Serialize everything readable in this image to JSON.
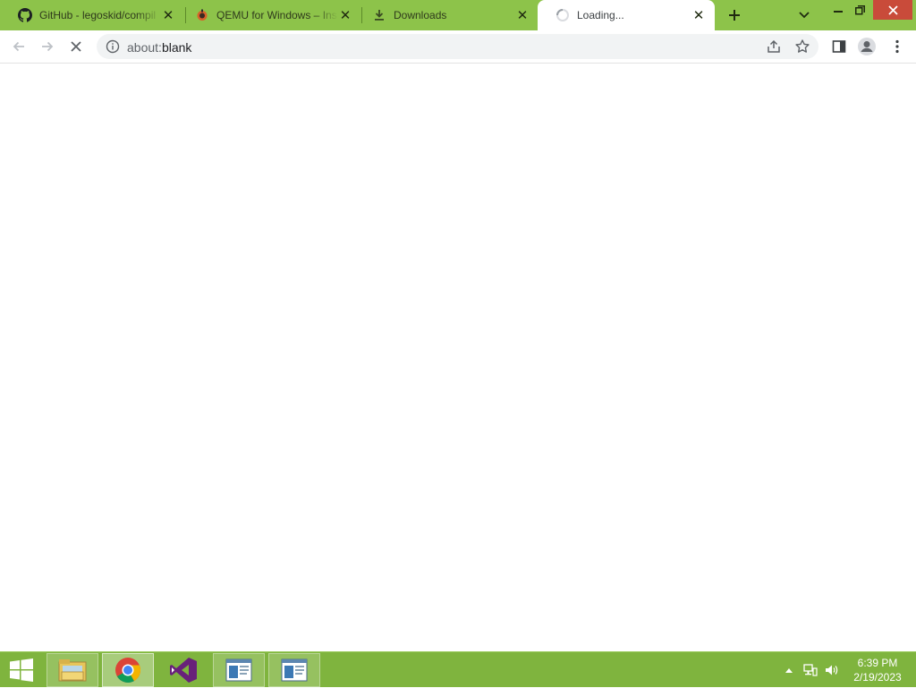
{
  "browser": {
    "tabs": [
      {
        "title": "GitHub - legoskid/compil",
        "icon": "github-icon",
        "active": false
      },
      {
        "title": "QEMU for Windows – Ins",
        "icon": "qemu-icon",
        "active": false
      },
      {
        "title": "Downloads",
        "icon": "download-icon",
        "active": false
      },
      {
        "title": "Loading...",
        "icon": "loading-spinner-icon",
        "active": true
      }
    ],
    "address": {
      "scheme": "about:",
      "host": "blank"
    },
    "page_state": "loading"
  },
  "taskbar": {
    "apps": [
      {
        "name": "file-explorer",
        "icon": "folder-icon"
      },
      {
        "name": "chrome",
        "icon": "chrome-icon"
      },
      {
        "name": "visual-studio",
        "icon": "visual-studio-icon"
      },
      {
        "name": "window-1",
        "icon": "window-icon"
      },
      {
        "name": "window-2",
        "icon": "window-icon"
      }
    ],
    "clock": {
      "time": "6:39 PM",
      "date": "2/19/2023"
    }
  },
  "colors": {
    "frame": "#8dc34a",
    "taskbar": "#7fb43e",
    "close_button": "#c94b3a"
  }
}
